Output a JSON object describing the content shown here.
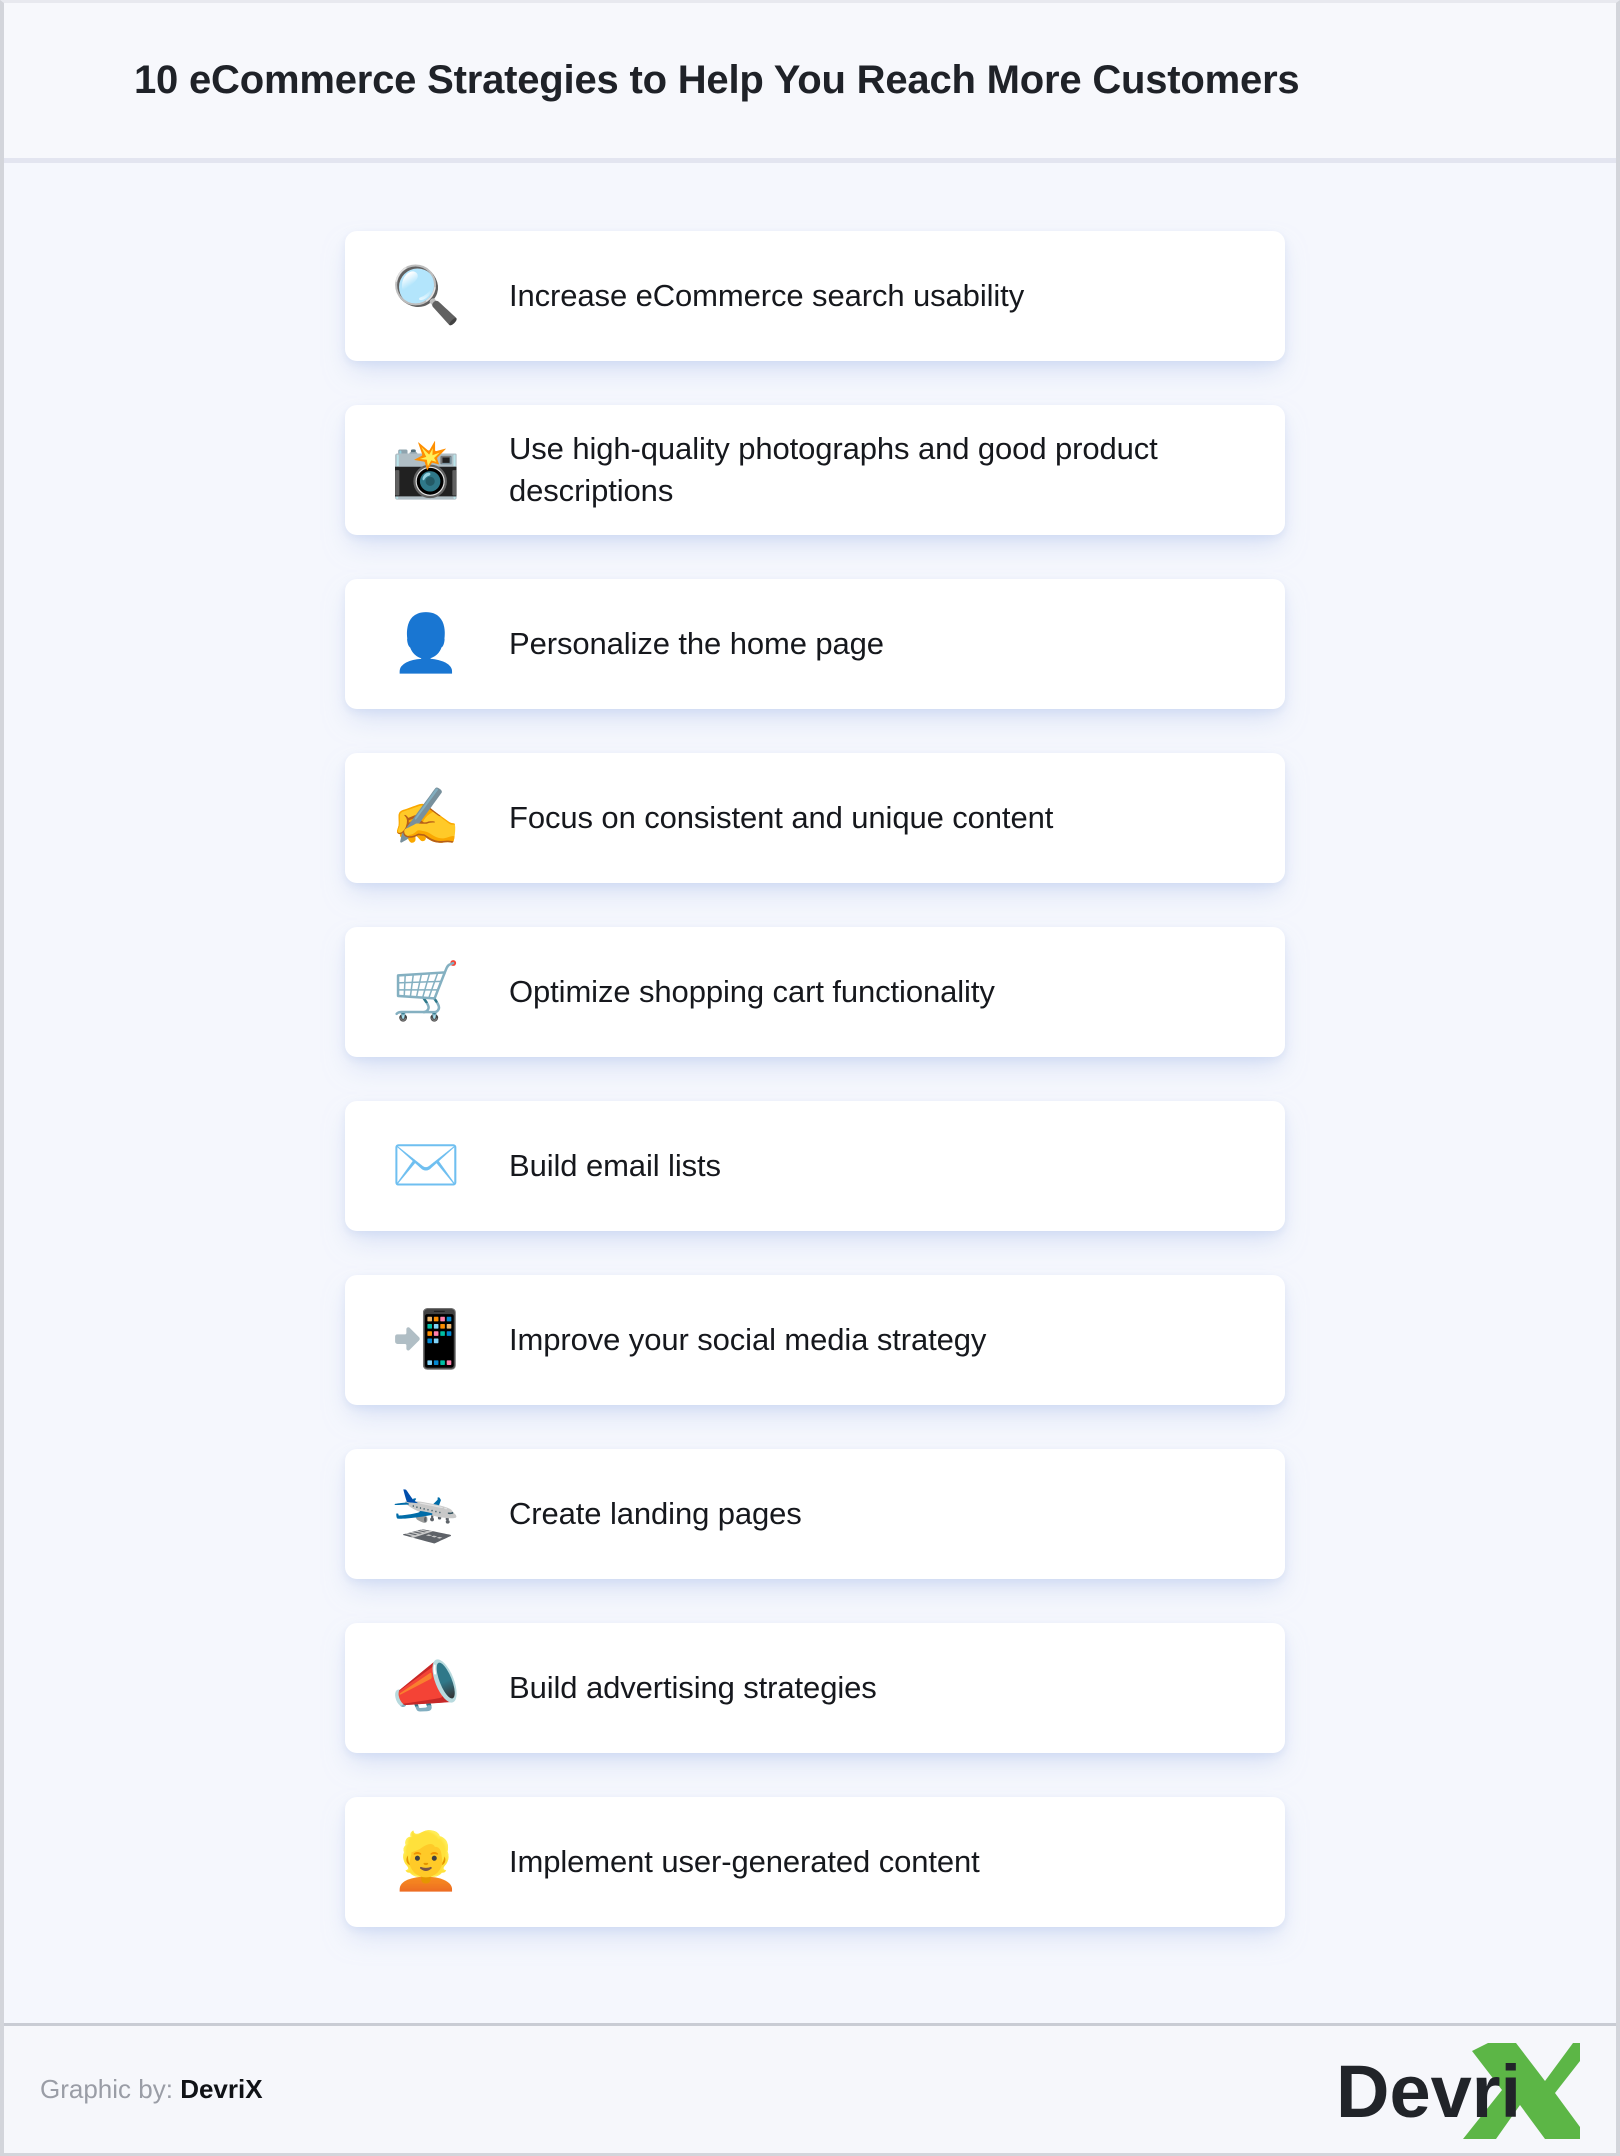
{
  "header": {
    "title": "10 eCommerce Strategies to Help You Reach More Customers"
  },
  "strategies": [
    {
      "icon": "🔍",
      "icon_name": "magnifying-glass-icon",
      "label": "Increase eCommerce search usability"
    },
    {
      "icon": "📸",
      "icon_name": "camera-with-flash-icon",
      "label": "Use high-quality photographs and good product descriptions"
    },
    {
      "icon": "👤",
      "icon_name": "bust-in-silhouette-icon",
      "label": "Personalize the home page"
    },
    {
      "icon": "✍️",
      "icon_name": "writing-hand-icon",
      "label": "Focus on consistent and unique content"
    },
    {
      "icon": "🛒",
      "icon_name": "shopping-cart-icon",
      "label": "Optimize shopping cart functionality"
    },
    {
      "icon": "✉️",
      "icon_name": "envelope-icon",
      "label": "Build email lists"
    },
    {
      "icon": "📲",
      "icon_name": "mobile-phone-with-arrow-icon",
      "label": "Improve your social media strategy"
    },
    {
      "icon": "🛬",
      "icon_name": "airplane-arriving-icon",
      "label": "Create landing pages"
    },
    {
      "icon": "📣",
      "icon_name": "megaphone-icon",
      "label": "Build advertising strategies"
    },
    {
      "icon": "👱",
      "icon_name": "person-blond-hair-icon",
      "label": "Implement user-generated content"
    }
  ],
  "footer": {
    "credit_prefix": "Graphic by:",
    "credit_brand": "DevriX",
    "logo_text": "Devri",
    "logo_mark": "X",
    "logo_accent_color": "#5cb646",
    "logo_text_color": "#212429"
  },
  "colors": {
    "page_background": "#f6f7fb",
    "body_background": "#f5f7fd",
    "card_background": "#ffffff",
    "title_color": "#1f2228",
    "label_color": "#16181d",
    "credit_muted": "#9a9da6"
  }
}
